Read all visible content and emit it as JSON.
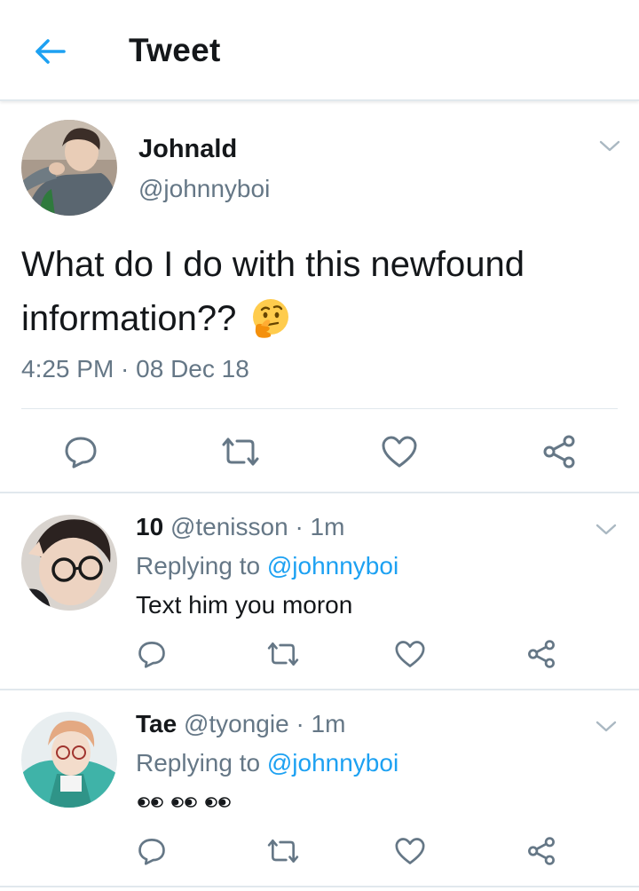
{
  "header": {
    "title": "Tweet"
  },
  "main_tweet": {
    "display_name": "Johnald",
    "handle": "@johnnyboi",
    "text_line1": "What do I do with this newfound",
    "text_line2": "information??",
    "emoji": "thinking-face",
    "timestamp": "4:25 PM · 08 Dec 18"
  },
  "replies": [
    {
      "display_name": "10",
      "handle": "@tenisson",
      "age": "· 1m",
      "replying_prefix": "Replying to",
      "replying_handle": "@johnnyboi",
      "text": "Text him you moron",
      "emoji": ""
    },
    {
      "display_name": "Tae",
      "handle": "@tyongie",
      "age": "· 1m",
      "replying_prefix": "Replying to",
      "replying_handle": "@johnnyboi",
      "text": "",
      "emoji": "eyes-emoji x3"
    }
  ],
  "icons": {
    "back": "arrow-left-icon",
    "reply": "reply-icon",
    "retweet": "retweet-icon",
    "like": "heart-icon",
    "share": "share-icon",
    "menu": "chevron-down-icon"
  },
  "colors": {
    "accent": "#1da1f2",
    "text": "#14171a",
    "secondary": "#657786",
    "divider": "#e1e8ed"
  }
}
